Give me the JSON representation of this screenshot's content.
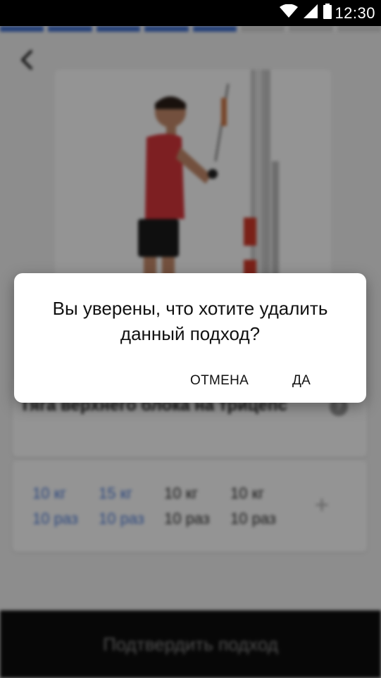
{
  "status_bar": {
    "time": "12:30",
    "icons": [
      "wifi-icon",
      "signal-icon",
      "battery-icon"
    ]
  },
  "progress": {
    "segments_total": 8,
    "segments_done": 5,
    "accent": "#3f6fd0"
  },
  "header": {
    "back_icon": "chevron-left-icon"
  },
  "exercise": {
    "name": "Тяга верхнего блока на трицепс",
    "info_icon": "?"
  },
  "sets": [
    {
      "weight": "10 кг",
      "reps": "10 раз",
      "completed": true
    },
    {
      "weight": "15 кг",
      "reps": "10 раз",
      "completed": true
    },
    {
      "weight": "10 кг",
      "reps": "10 раз",
      "completed": false
    },
    {
      "weight": "10 кг",
      "reps": "10 раз",
      "completed": false
    }
  ],
  "add_set_label": "+",
  "bottom_bar": {
    "confirm_label": "Подтвердить подход"
  },
  "dialog": {
    "message": "Вы уверены, что хотите удалить данный подход?",
    "cancel_label": "ОТМЕНА",
    "confirm_label": "ДА"
  },
  "colors": {
    "completed_set": "#4a7ad8",
    "dialog_bg": "#ffffff",
    "bottom_bar_bg": "#0d0d0d"
  }
}
